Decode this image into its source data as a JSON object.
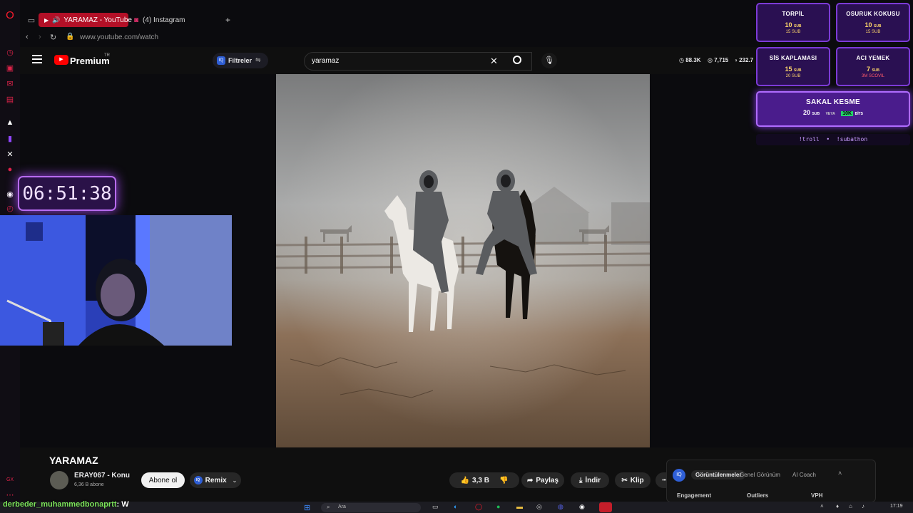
{
  "browser": {
    "tabs": [
      {
        "label": "YARAMAZ - YouTube",
        "active": true
      },
      {
        "label": "(4) Instagram",
        "active": false
      }
    ],
    "new_tab": "+",
    "url": "www.youtube.com/watch"
  },
  "youtube": {
    "logo": "Premium",
    "region": "TR",
    "filters_label": "Filtreler",
    "search_value": "yaramaz",
    "stats": {
      "views": "88.3K",
      "eye": "7,715",
      "other": "232.7"
    }
  },
  "video": {
    "title": "YARAMAZ",
    "channel": "ERAY067 - Konu",
    "subscribers": "6,36 B abone",
    "subscribe_label": "Abone ol",
    "remix_label": "Remix",
    "likes": "3,3 B",
    "share_label": "Paylaş",
    "download_label": "İndir",
    "clip_label": "Klip",
    "more": "•••"
  },
  "analytics": {
    "badge": "IQ",
    "tabs": [
      "Görüntülenmeler",
      "Genel Görünüm",
      "AI Coach"
    ],
    "columns": [
      "Engagement",
      "Outliers",
      "VPH"
    ]
  },
  "stream_overlay": {
    "timer": "06:51:38",
    "cards": [
      {
        "title": "TORPİL",
        "amount": "10",
        "unit": "SUB",
        "sub": "15 SUB"
      },
      {
        "title": "OSURUK KOKUSU",
        "amount": "10",
        "unit": "SUB",
        "sub": "15 SUB"
      },
      {
        "title": "SİS KAPLAMASI",
        "amount": "15",
        "unit": "SUB",
        "sub": "20 SUB"
      },
      {
        "title": "ACI YEMEK",
        "amount": "7",
        "unit": "SUB",
        "sub": "3M SCOVIL"
      },
      {
        "title": "SAKAL KESME",
        "amount": "20",
        "unit": "SUB",
        "sub": "VEYA",
        "extra": "10K",
        "extra_unit": "BİTS"
      }
    ],
    "commands": "!troll  •  !subathon",
    "chat": {
      "user": "derbeder_muhammedbonaprtt",
      "message": ": W"
    }
  },
  "taskbar": {
    "search_placeholder": "Ara",
    "time": "17:19"
  },
  "colors": {
    "accent_red": "#b31027",
    "overlay_purple": "#7c3bd6",
    "chat_green": "#7be35a"
  }
}
